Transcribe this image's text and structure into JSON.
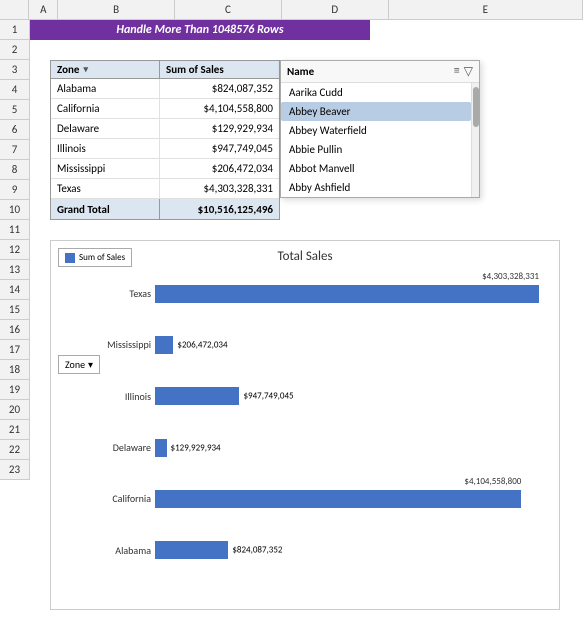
{
  "columns": [
    "",
    "A",
    "B",
    "C",
    "D",
    "E"
  ],
  "rows": [
    1,
    2,
    3,
    4,
    5,
    6,
    7,
    8,
    9,
    10,
    11,
    12,
    13,
    14,
    15,
    16,
    17,
    18,
    19,
    20,
    21,
    22,
    23
  ],
  "title": "Handle More Than 1048576 Rows",
  "pivot": {
    "headers": [
      "Zone",
      "Sum of Sales"
    ],
    "rows": [
      [
        "Alabama",
        "$824,087,352"
      ],
      [
        "California",
        "$4,104,558,800"
      ],
      [
        "Delaware",
        "$129,929,934"
      ],
      [
        "Illinois",
        "$947,749,045"
      ],
      [
        "Mississippi",
        "$206,472,034"
      ],
      [
        "Texas",
        "$4,303,328,331"
      ]
    ],
    "total_label": "Grand Total",
    "total_value": "$10,516,125,496"
  },
  "filter": {
    "title": "Name",
    "items": [
      {
        "label": "Aarika Cudd",
        "selected": false
      },
      {
        "label": "Abbey Beaver",
        "selected": true
      },
      {
        "label": "Abbey Waterfield",
        "selected": false
      },
      {
        "label": "Abbie Pullin",
        "selected": false
      },
      {
        "label": "Abbot Manvell",
        "selected": false
      },
      {
        "label": "Abby Ashfield",
        "selected": false
      }
    ]
  },
  "chart": {
    "title": "Total Sales",
    "legend_label": "Sum of Sales",
    "zone_label": "Zone",
    "bars": [
      {
        "label": "Texas",
        "value": "$4,303,328,331",
        "pct": 100,
        "value_above": true
      },
      {
        "label": "Mississippi",
        "value": "$206,472,034",
        "pct": 4.8,
        "value_above": false
      },
      {
        "label": "Illinois",
        "value": "$947,749,045",
        "pct": 22,
        "value_above": false
      },
      {
        "label": "Delaware",
        "value": "$129,929,934",
        "pct": 3,
        "value_above": false
      },
      {
        "label": "California",
        "value": "$4,104,558,800",
        "pct": 95.4,
        "value_above": true
      },
      {
        "label": "Alabama",
        "value": "$824,087,352",
        "pct": 19.1,
        "value_above": false
      }
    ]
  },
  "ui": {
    "dropdown_arrow": "▾",
    "filter_icon_1": "≡",
    "filter_icon_2": "▽",
    "zone_filter_arrow": "▾",
    "scroll_thumb": "█"
  }
}
